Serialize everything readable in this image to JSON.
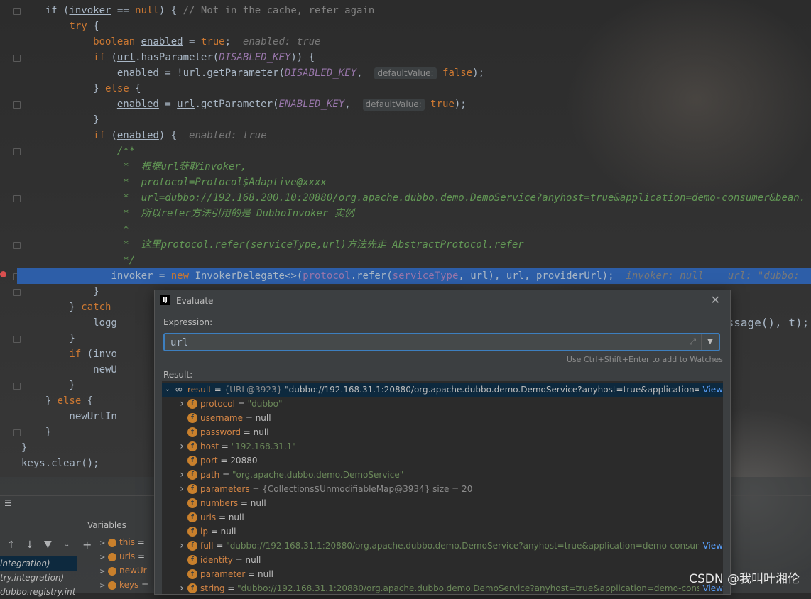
{
  "code": {
    "lines": [
      {
        "segs": [
          [
            "p",
            "    if ("
          ],
          [
            "vu",
            "invoker"
          ],
          [
            "p",
            " == "
          ],
          [
            "k",
            "null"
          ],
          [
            "p",
            ") { "
          ],
          [
            "c",
            "// Not in the cache, refer again"
          ]
        ]
      },
      {
        "segs": [
          [
            "k",
            "        try"
          ],
          [
            "p",
            " {"
          ]
        ]
      },
      {
        "segs": [
          [
            "k",
            "            boolean "
          ],
          [
            "vu",
            "enabled"
          ],
          [
            "p",
            " = "
          ],
          [
            "k",
            "true"
          ],
          [
            "p",
            ";  "
          ],
          [
            "h",
            "enabled: true"
          ]
        ]
      },
      {
        "segs": [
          [
            "k",
            "            if"
          ],
          [
            "p",
            " ("
          ],
          [
            "vu",
            "url"
          ],
          [
            "p",
            ".hasParameter("
          ],
          [
            "s",
            "DISABLED_KEY"
          ],
          [
            "p",
            ")) {"
          ]
        ]
      },
      {
        "segs": [
          [
            "p",
            "                "
          ],
          [
            "vu",
            "enabled"
          ],
          [
            "p",
            " = !"
          ],
          [
            "vu",
            "url"
          ],
          [
            "p",
            ".getParameter("
          ],
          [
            "s",
            "DISABLED_KEY"
          ],
          [
            "p",
            ",  "
          ],
          [
            "pill",
            "defaultValue:"
          ],
          [
            "p",
            " "
          ],
          [
            "k",
            "false"
          ],
          [
            "p",
            ");"
          ]
        ]
      },
      {
        "segs": [
          [
            "p",
            "            } "
          ],
          [
            "k",
            "else"
          ],
          [
            "p",
            " {"
          ]
        ]
      },
      {
        "segs": [
          [
            "p",
            "                "
          ],
          [
            "vu",
            "enabled"
          ],
          [
            "p",
            " = "
          ],
          [
            "vu",
            "url"
          ],
          [
            "p",
            ".getParameter("
          ],
          [
            "s",
            "ENABLED_KEY"
          ],
          [
            "p",
            ",  "
          ],
          [
            "pill",
            "defaultValue:"
          ],
          [
            "p",
            " "
          ],
          [
            "k",
            "true"
          ],
          [
            "p",
            ");"
          ]
        ]
      },
      {
        "segs": [
          [
            "p",
            "            }"
          ]
        ]
      },
      {
        "segs": [
          [
            "k",
            "            if"
          ],
          [
            "p",
            " ("
          ],
          [
            "vu",
            "enabled"
          ],
          [
            "p",
            ") {  "
          ],
          [
            "h",
            "enabled: true"
          ]
        ]
      },
      {
        "segs": [
          [
            "d",
            "                /**"
          ]
        ]
      },
      {
        "segs": [
          [
            "d",
            "                 *  根据url获取invoker,"
          ]
        ]
      },
      {
        "segs": [
          [
            "d",
            "                 *  protocol=Protocol$Adaptive@xxxx"
          ]
        ]
      },
      {
        "segs": [
          [
            "d",
            "                 *  url=dubbo://192.168.200.10:20880/org.apache.dubbo.demo.DemoService?anyhost=true&application=demo-consumer&bean."
          ]
        ]
      },
      {
        "segs": [
          [
            "d",
            "                 *  所以refer方法引用的是 DubboInvoker 实例"
          ]
        ]
      },
      {
        "segs": [
          [
            "d",
            "                 *"
          ]
        ]
      },
      {
        "segs": [
          [
            "d",
            "                 *  这里protocol.refer(serviceType,url)方法先走 AbstractProtocol.refer"
          ]
        ]
      },
      {
        "segs": [
          [
            "d",
            "                 */"
          ]
        ]
      },
      {
        "hl": true,
        "segs": [
          [
            "p",
            "               "
          ],
          [
            "vu",
            "invoker"
          ],
          [
            "p",
            " = "
          ],
          [
            "k",
            "new"
          ],
          [
            "p",
            " InvokerDelegate<>("
          ],
          [
            "f",
            "protocol"
          ],
          [
            "p",
            ".refer("
          ],
          [
            "f",
            "serviceType"
          ],
          [
            "p",
            ", url), "
          ],
          [
            "vu",
            "url"
          ],
          [
            "p",
            ", providerUrl);  "
          ],
          [
            "h",
            "invoker: null    url: \"dubbo:"
          ]
        ]
      },
      {
        "segs": [
          [
            "p",
            "            }"
          ]
        ]
      },
      {
        "segs": [
          [
            "p",
            "        } "
          ],
          [
            "k",
            "catch"
          ]
        ]
      },
      {
        "segs": [
          [
            "p",
            "            logg"
          ]
        ]
      },
      {
        "segs": [
          [
            "p",
            "        }"
          ]
        ]
      },
      {
        "segs": [
          [
            "k",
            "        if"
          ],
          [
            "p",
            " (invo"
          ]
        ]
      },
      {
        "segs": [
          [
            "p",
            "            newU"
          ]
        ]
      },
      {
        "segs": [
          [
            "p",
            "        }"
          ]
        ]
      },
      {
        "segs": [
          [
            "p",
            "    } "
          ],
          [
            "k",
            "else"
          ],
          [
            "p",
            " {"
          ]
        ]
      },
      {
        "segs": [
          [
            "p",
            "        newUrlIn"
          ]
        ]
      },
      {
        "segs": [
          [
            "p",
            "    }"
          ]
        ]
      },
      {
        "segs": [
          [
            "p",
            "}"
          ]
        ]
      },
      {
        "segs": [
          [
            "p",
            "keys.clear();"
          ]
        ]
      }
    ],
    "right_fragment": "essage(), t);"
  },
  "variables_panel": {
    "title": "Variables",
    "frames": [
      "integration)",
      "try.integration)",
      "dubbo.registry.int"
    ],
    "vars": [
      {
        "name": "this",
        "value": "="
      },
      {
        "name": "urls",
        "value": "="
      },
      {
        "name": "newUr",
        "value": ""
      },
      {
        "name": "keys",
        "value": "="
      }
    ]
  },
  "dialog": {
    "title": "Evaluate",
    "expression_label": "Expression:",
    "expression_value": "url",
    "hint": "Use Ctrl+Shift+Enter to add to Watches",
    "result_label": "Result:",
    "view_label": "View",
    "result": {
      "name": "result",
      "ref": "{URL@3923}",
      "value": "\"dubbo://192.168.31.1:20880/org.apache.dubbo.demo.DemoService?anyhost=true&application=de"
    },
    "fields": [
      {
        "name": "protocol",
        "value": "\"dubbo\"",
        "type": "str",
        "expandable": true
      },
      {
        "name": "username",
        "value": "null",
        "type": "plain",
        "expandable": false
      },
      {
        "name": "password",
        "value": "null",
        "type": "plain",
        "expandable": false
      },
      {
        "name": "host",
        "value": "\"192.168.31.1\"",
        "type": "str",
        "expandable": true
      },
      {
        "name": "port",
        "value": "20880",
        "type": "plain",
        "expandable": false
      },
      {
        "name": "path",
        "value": "\"org.apache.dubbo.demo.DemoService\"",
        "type": "str",
        "expandable": true
      },
      {
        "name": "parameters",
        "value": "{Collections$UnmodifiableMap@3934}  size = 20",
        "type": "ref",
        "expandable": true
      },
      {
        "name": "numbers",
        "value": "null",
        "type": "plain",
        "expandable": false
      },
      {
        "name": "urls",
        "value": "null",
        "type": "plain",
        "expandable": false
      },
      {
        "name": "ip",
        "value": "null",
        "type": "plain",
        "expandable": false
      },
      {
        "name": "full",
        "value": "\"dubbo://192.168.31.1:20880/org.apache.dubbo.demo.DemoService?anyhost=true&application=demo-consume",
        "type": "str",
        "expandable": true,
        "view": true
      },
      {
        "name": "identity",
        "value": "null",
        "type": "plain",
        "expandable": false
      },
      {
        "name": "parameter",
        "value": "null",
        "type": "plain",
        "expandable": false
      },
      {
        "name": "string",
        "value": "\"dubbo://192.168.31.1:20880/org.apache.dubbo.demo.DemoService?anyhost=true&application=demo-consu",
        "type": "str",
        "expandable": true,
        "view": true
      }
    ]
  },
  "watermark": "CSDN @我叫叶湘伦",
  "icons": [
    "breakpoint-icon",
    "fold-icon",
    "intellij-icon",
    "close-icon",
    "expand-icon",
    "dropdown-icon",
    "chevron-right-icon",
    "chevron-down-icon",
    "field-icon",
    "watch-icon",
    "arrow-up-icon",
    "arrow-down-icon",
    "filter-icon",
    "add-icon"
  ]
}
